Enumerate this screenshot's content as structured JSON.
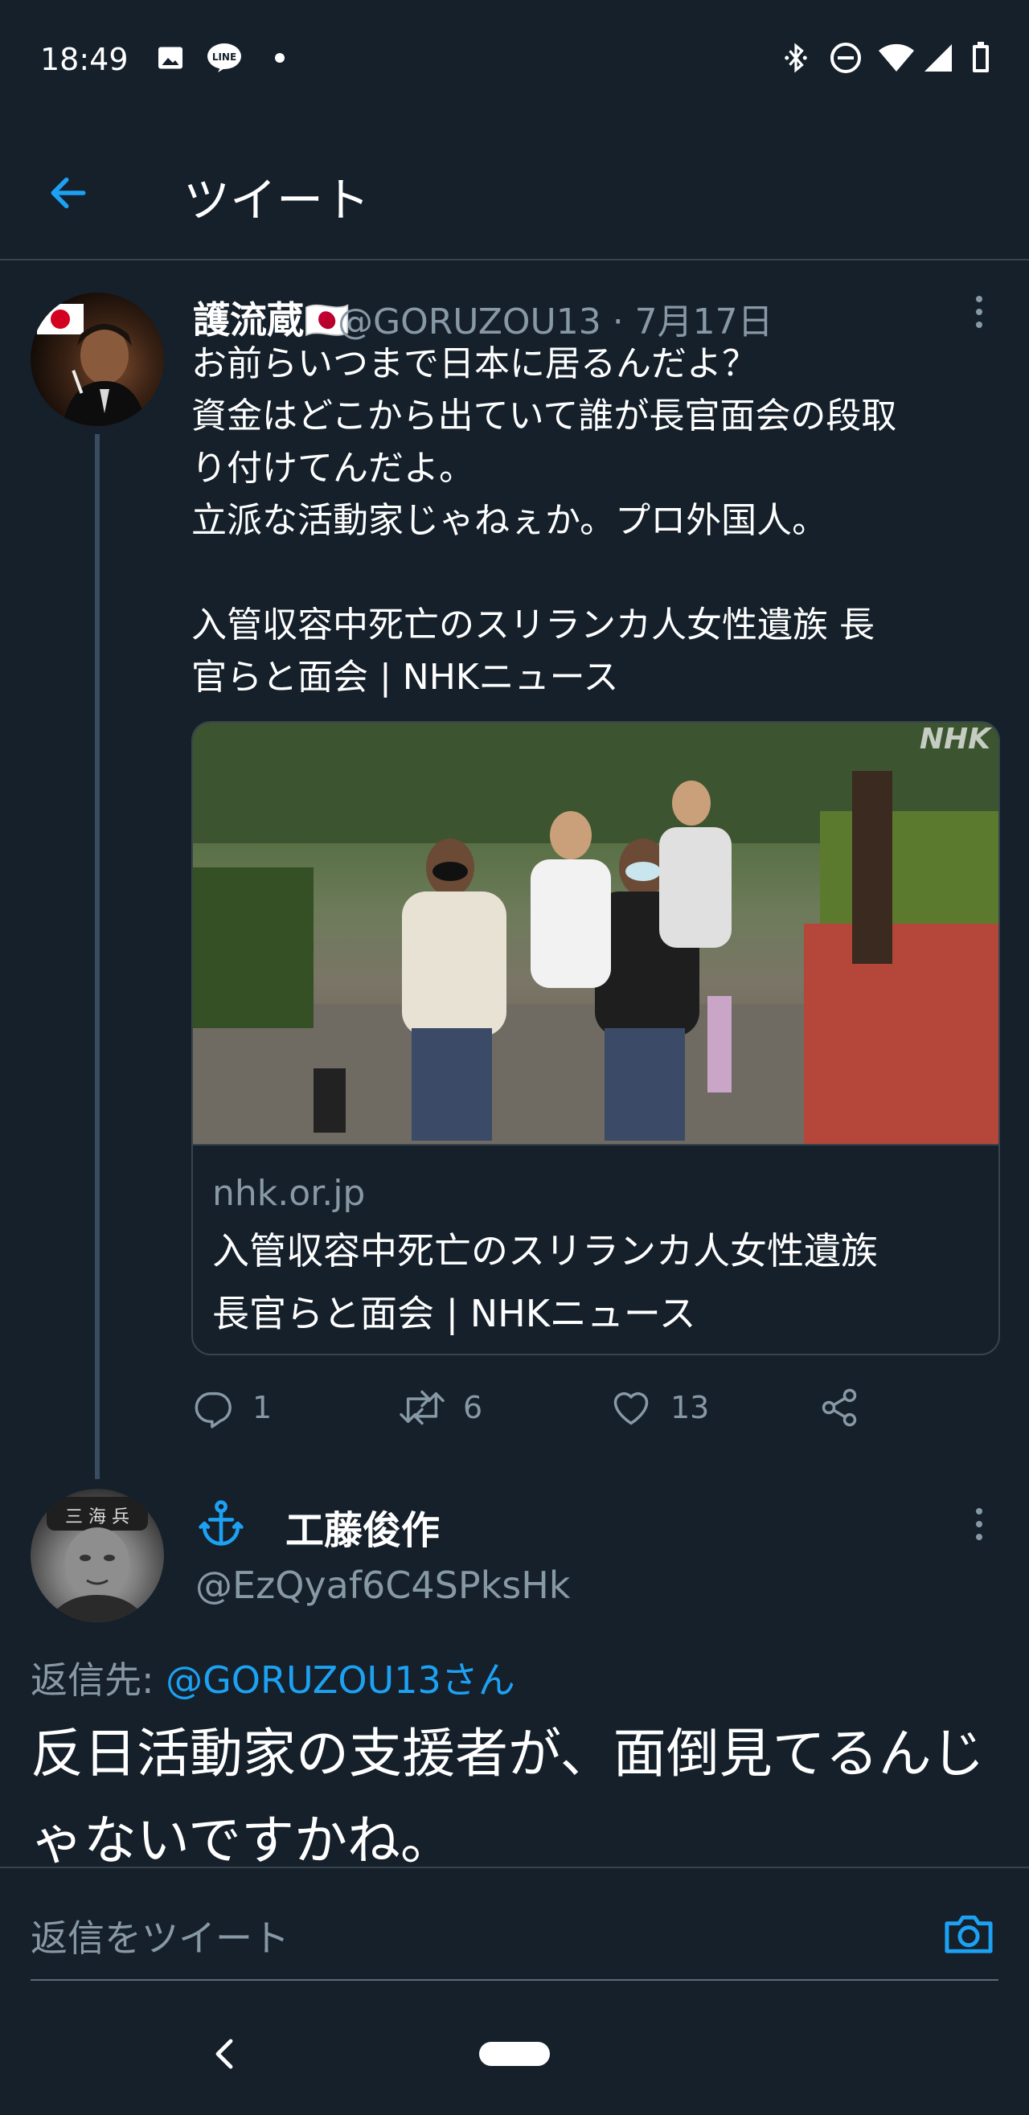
{
  "status_bar": {
    "time": "18:49",
    "left_icons": [
      "image-icon",
      "line-app-icon",
      "dot-icon"
    ],
    "right_icons": [
      "bluetooth-icon",
      "do-not-disturb-icon",
      "wifi-icon",
      "signal-icon",
      "battery-icon"
    ]
  },
  "header": {
    "title": "ツイート",
    "back_icon": "arrow-left-icon"
  },
  "tweet": {
    "author_name": "護流蔵🇯🇵",
    "author_meta": "@GORUZOU13 · 7月17日",
    "body": "お前らいつまで日本に居るんだよ？\n資金はどこから出ていて誰が長官面会の段取\nり付けてんだよ。\n立派な活動家じゃねぇか。プロ外国人。\n\n入管収容中死亡のスリランカ人女性遺族 長\n官らと面会 | NHKニュース",
    "card": {
      "watermark": "NHK",
      "domain": "nhk.or.jp",
      "title": "入管収容中死亡のスリランカ人女性遺族\n長官らと面会 | NHKニュース"
    },
    "actions": {
      "replies": "1",
      "retweets": "6",
      "likes": "13"
    }
  },
  "reply": {
    "author_name": "工藤俊作",
    "author_handle": "@EzQyaf6C4SPksHk",
    "reply_prefix": "返信先: ",
    "reply_target": "@GORUZOU13さん",
    "body": "反日活動家の支援者が、面倒見てるんじゃないですかね。"
  },
  "compose": {
    "placeholder": "返信をツイート"
  },
  "colors": {
    "background": "#15202b",
    "accent": "#1da1f2",
    "secondary_text": "#8899a6",
    "divider": "#38444d"
  }
}
